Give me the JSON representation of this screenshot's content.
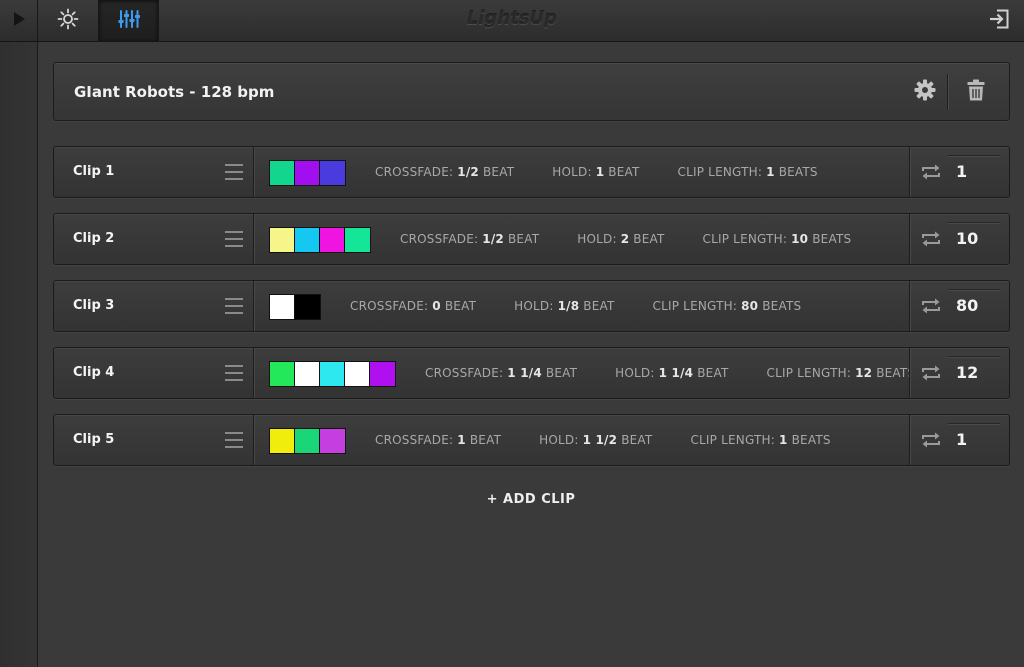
{
  "app": {
    "title": "LightsUp"
  },
  "scene": {
    "title": "GIant Robots - 128 bpm"
  },
  "labels": {
    "crossfade": "CROSSFADE:",
    "hold": "HOLD:",
    "clip_length": "CLIP LENGTH:"
  },
  "clips": [
    {
      "name": "Clip 1",
      "colors": [
        "#12d68e",
        "#a10ef0",
        "#4a3bde"
      ],
      "crossfade_value": "1/2",
      "crossfade_unit": "BEAT",
      "hold_value": "1",
      "hold_unit": "BEAT",
      "length_value": "1",
      "length_unit": "BEATS",
      "repeat": "1"
    },
    {
      "name": "Clip 2",
      "colors": [
        "#f6f58a",
        "#14c8f2",
        "#f014e0",
        "#14e596"
      ],
      "crossfade_value": "1/2",
      "crossfade_unit": "BEAT",
      "hold_value": "2",
      "hold_unit": "BEAT",
      "length_value": "10",
      "length_unit": "BEATS",
      "repeat": "10"
    },
    {
      "name": "Clip 3",
      "colors": [
        "#ffffff",
        "#000000"
      ],
      "crossfade_value": "0",
      "crossfade_unit": "BEAT",
      "hold_value": "1/8",
      "hold_unit": "BEAT",
      "length_value": "80",
      "length_unit": "BEATS",
      "repeat": "80"
    },
    {
      "name": "Clip 4",
      "colors": [
        "#22e85a",
        "#ffffff",
        "#2ee8f0",
        "#ffffff",
        "#b010f0"
      ],
      "crossfade_value": "1 1/4",
      "crossfade_unit": "BEAT",
      "hold_value": "1 1/4",
      "hold_unit": "BEAT",
      "length_value": "12",
      "length_unit": "BEATS",
      "repeat": "12"
    },
    {
      "name": "Clip 5",
      "colors": [
        "#f0ec0c",
        "#1ad678",
        "#c43ee0"
      ],
      "crossfade_value": "1",
      "crossfade_unit": "BEAT",
      "hold_value": "1 1/2",
      "hold_unit": "BEAT",
      "length_value": "1",
      "length_unit": "BEATS",
      "repeat": "1"
    }
  ],
  "add_clip_label": "+ ADD CLIP",
  "icons": {
    "play": "play-icon",
    "brightness": "brightness-icon",
    "mixer": "mixer-sliders-icon",
    "exit": "exit-icon",
    "settings": "gear-icon",
    "delete": "trash-icon",
    "drag": "drag-handle-icon",
    "repeat": "repeat-icon"
  },
  "colors": {
    "accent": "#3c9cf0",
    "background": "#3a3a3a"
  }
}
